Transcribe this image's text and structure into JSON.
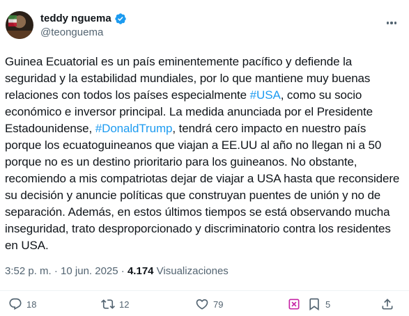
{
  "author": {
    "display_name": "teddy nguema",
    "handle": "@teonguema",
    "verified": true
  },
  "tweet": {
    "segments": [
      {
        "text": "Guinea Ecuatorial es un país eminentemente pacífico y defiende la seguridad y la estabilidad mundiales, por lo que mantiene muy buenas relaciones con todos los países especialmente ",
        "type": "text"
      },
      {
        "text": "#USA",
        "type": "hashtag"
      },
      {
        "text": ", como su socio económico e inversor principal. La medida anunciada por el Presidente Estadounidense, ",
        "type": "text"
      },
      {
        "text": "#DonaldTrump",
        "type": "hashtag"
      },
      {
        "text": ", tendrá cero impacto en nuestro país porque los ecuatoguineanos que viajan a EE.UU al año no llegan ni a 50 porque no es un destino prioritario para los guineanos. No obstante, recomiendo a mis compatriotas dejar de viajar a USA hasta que reconsidere su decisión y anuncie políticas que construyan puentes de unión y no de separación. Además, en estos últimos tiempos se está observando mucha inseguridad, trato desproporcionado y discriminatorio contra los residentes en USA.",
        "type": "text"
      }
    ]
  },
  "meta": {
    "time": "3:52 p. m.",
    "sep1": " · ",
    "date": "10 jun. 2025",
    "sep2": " · ",
    "views": "4.174",
    "views_label": " Visualizaciones"
  },
  "actions": {
    "replies": "18",
    "retweets": "12",
    "likes": "79",
    "bookmarks": "5"
  },
  "icons": [
    "verified-icon",
    "more-icon",
    "reply-icon",
    "retweet-icon",
    "like-icon",
    "grok-icon",
    "bookmark-icon",
    "share-icon"
  ],
  "colors": {
    "accent": "#1d9bf0",
    "text": "#0f1419",
    "muted": "#536471",
    "grok": "#c626a6"
  }
}
